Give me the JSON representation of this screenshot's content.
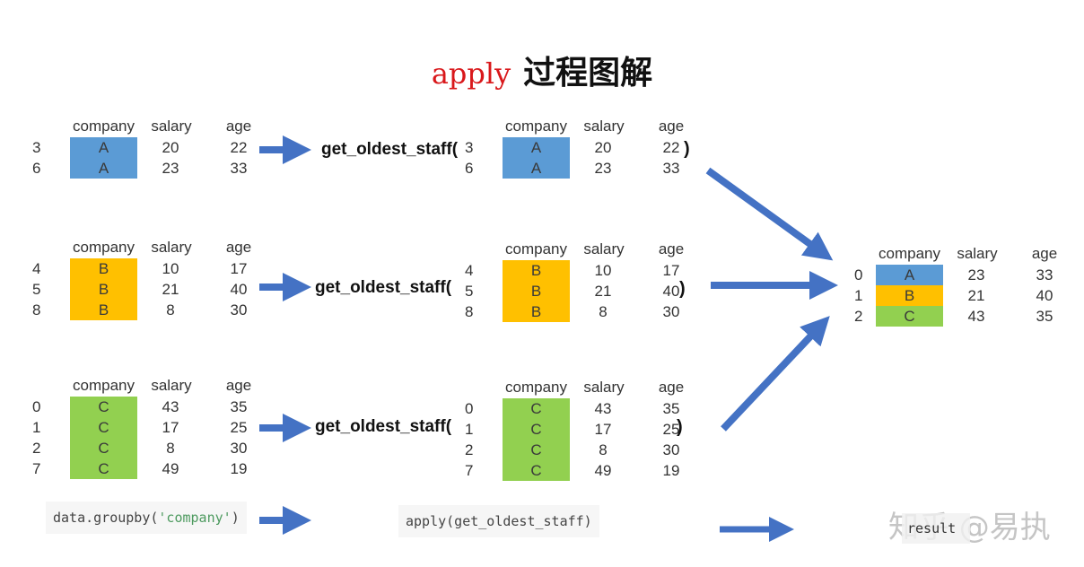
{
  "title": {
    "code": "apply",
    "text": "过程图解"
  },
  "colors": {
    "A": "#5b9bd5",
    "B": "#ffc000",
    "C": "#92d050",
    "arrow": "#4472c4",
    "title_code": "#d9181b"
  },
  "columns": {
    "company": "company",
    "salary": "salary",
    "age": "age"
  },
  "function_label": "get_oldest_staff(",
  "close_paren": ")",
  "groups": [
    {
      "company": "A",
      "rows": [
        {
          "idx": "3",
          "company": "A",
          "salary": "20",
          "age": "22"
        },
        {
          "idx": "6",
          "company": "A",
          "salary": "23",
          "age": "33"
        }
      ]
    },
    {
      "company": "B",
      "rows": [
        {
          "idx": "4",
          "company": "B",
          "salary": "10",
          "age": "17"
        },
        {
          "idx": "5",
          "company": "B",
          "salary": "21",
          "age": "40"
        },
        {
          "idx": "8",
          "company": "B",
          "salary": "8",
          "age": "30"
        }
      ]
    },
    {
      "company": "C",
      "rows": [
        {
          "idx": "0",
          "company": "C",
          "salary": "43",
          "age": "35"
        },
        {
          "idx": "1",
          "company": "C",
          "salary": "17",
          "age": "25"
        },
        {
          "idx": "2",
          "company": "C",
          "salary": "8",
          "age": "30"
        },
        {
          "idx": "7",
          "company": "C",
          "salary": "49",
          "age": "19"
        }
      ]
    }
  ],
  "result": {
    "rows": [
      {
        "idx": "0",
        "company": "A",
        "salary": "23",
        "age": "33"
      },
      {
        "idx": "1",
        "company": "B",
        "salary": "21",
        "age": "40"
      },
      {
        "idx": "2",
        "company": "C",
        "salary": "43",
        "age": "35"
      }
    ]
  },
  "code": {
    "groupby_prefix": "data.groupby(",
    "groupby_arg": "'company'",
    "groupby_suffix": ")",
    "apply": "apply(get_oldest_staff)",
    "result": "result"
  },
  "watermark": "知乎 @易执"
}
